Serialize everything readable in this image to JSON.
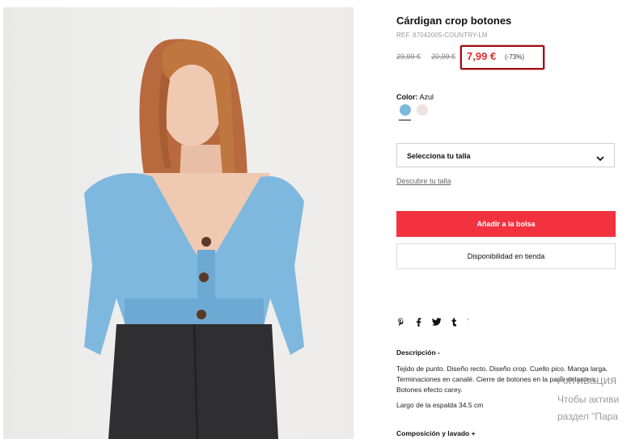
{
  "product": {
    "title": "Cárdigan crop botones",
    "ref": "REF. 87042005-COUNTRY-LM",
    "old_price_1": "29,99 €",
    "old_price_2": "20,99 €",
    "price": "7,99 €",
    "discount": "(-73%)"
  },
  "color": {
    "label": "Color:",
    "value": "Azul",
    "swatches": [
      {
        "name": "Azul",
        "hex": "#7fb8de",
        "selected": true
      },
      {
        "name": "Crudo",
        "hex": "#ede3df",
        "selected": false
      }
    ]
  },
  "size": {
    "select_label": "Selecciona tu talla",
    "guide_link": "Descubre tu talla"
  },
  "actions": {
    "add_to_bag": "Añadir a la bolsa",
    "store_availability": "Disponibilidad en tienda"
  },
  "social": {
    "icons": [
      "pinterest-icon",
      "facebook-icon",
      "twitter-icon",
      "tumblr-icon"
    ],
    "glyphs": [
      "𝓅",
      "f",
      "🐦",
      "t"
    ]
  },
  "description": {
    "title": "Descripción -",
    "text": "Tejido de punto. Diseño recto. Diseño crop. Cuello pico. Manga larga. Terminaciones en canalé. Cierre de botones en la parte delantera. Botones efecto carey.",
    "length": "Largo de la espalda 34.5 cm"
  },
  "composition": {
    "title": "Composición y lavado +"
  },
  "os_overlay": {
    "line1": "Активация",
    "line2": "Чтобы активи",
    "line3": "раздел \"Пара"
  },
  "colors": {
    "accent_red": "#f2323f",
    "price_red": "#e52b2b",
    "highlight_box": "#a00e19"
  }
}
